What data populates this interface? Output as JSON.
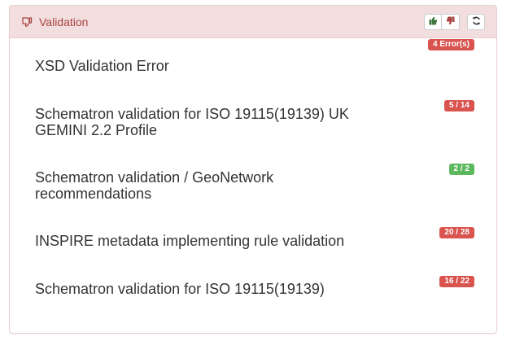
{
  "panel": {
    "title": "Validation",
    "title_icon": "thumbs-down-icon",
    "header_color": "#a94442",
    "header_background": "#f2dede",
    "buttons": [
      {
        "name": "thumbs-up-icon",
        "color": "#3c763d"
      },
      {
        "name": "thumbs-down-icon",
        "color": "#a94442"
      },
      {
        "name": "refresh-icon",
        "color": "#333333"
      }
    ]
  },
  "rows": [
    {
      "label": "XSD Validation Error",
      "badge": "4 Error(s)",
      "status": "error"
    },
    {
      "label": "Schematron validation for ISO 19115(19139) UK GEMINI 2.2 Profile",
      "badge": "5 / 14",
      "status": "error"
    },
    {
      "label": "Schematron validation / GeoNetwork recommendations",
      "badge": "2 / 2",
      "status": "success"
    },
    {
      "label": "INSPIRE metadata implementing rule validation",
      "badge": "20 / 28",
      "status": "error"
    },
    {
      "label": "Schematron validation for ISO 19115(19139)",
      "badge": "16 / 22",
      "status": "error"
    }
  ],
  "colors": {
    "error": "#d9534f",
    "success": "#5cb85c",
    "text": "#333333"
  }
}
